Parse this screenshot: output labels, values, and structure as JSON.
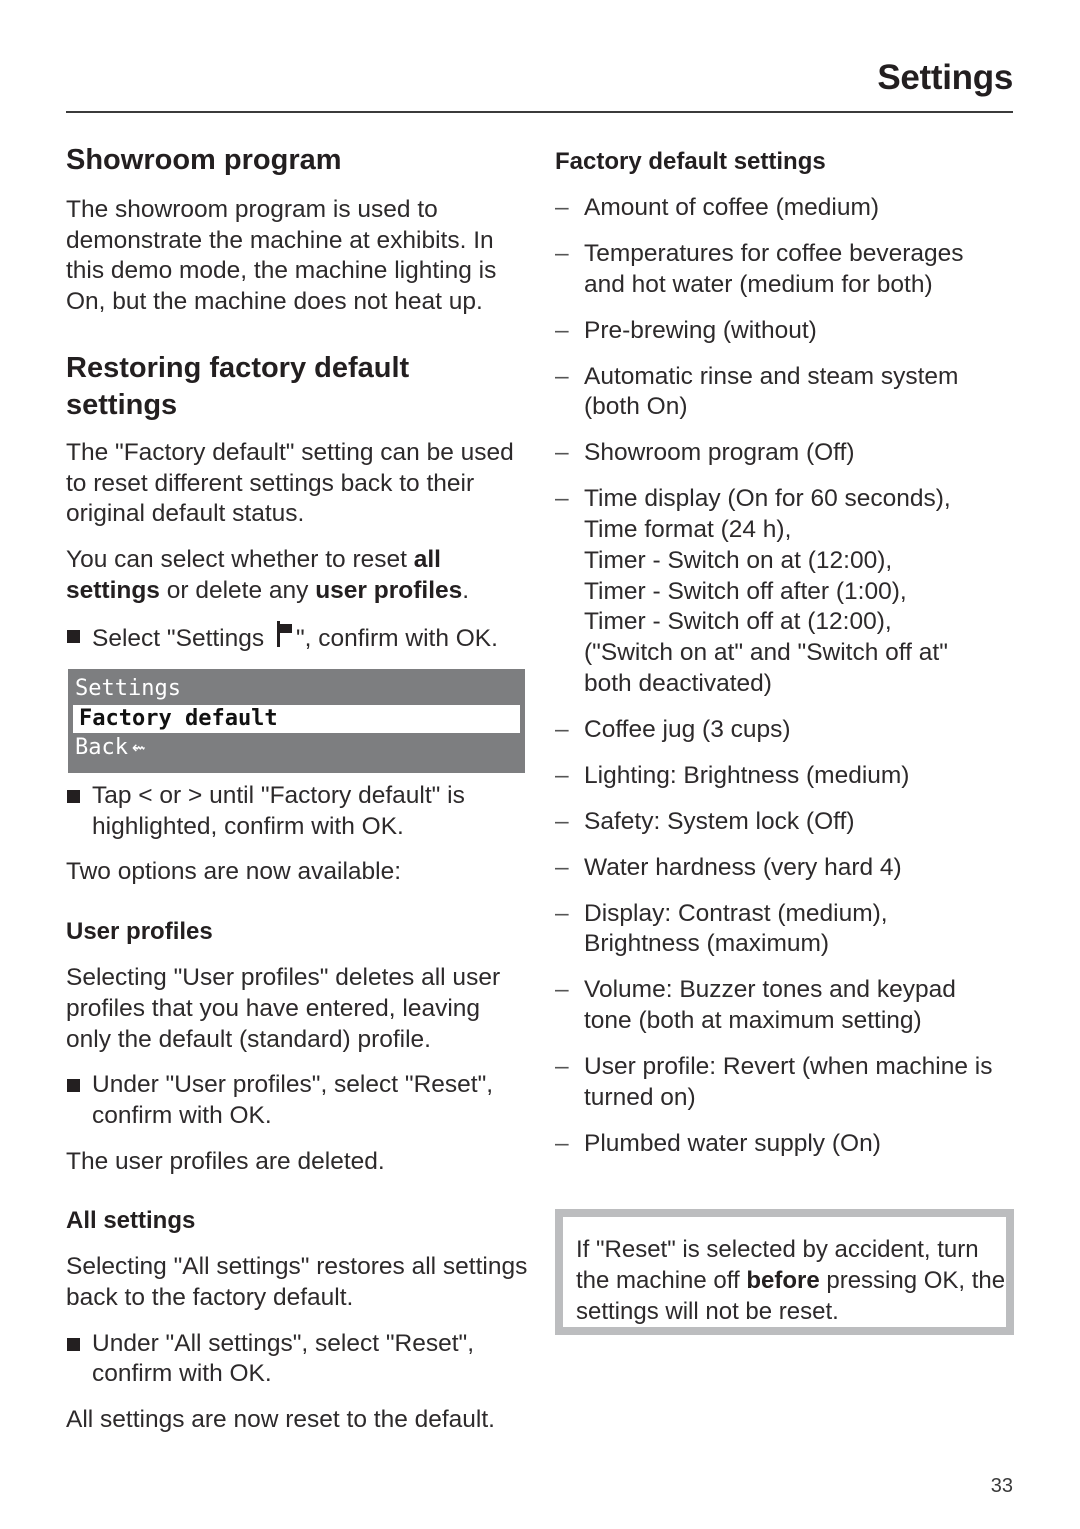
{
  "header": {
    "title": "Settings"
  },
  "left": {
    "showroom": {
      "heading": "Showroom program",
      "body": "The showroom program is used to demonstrate the machine at exhibits. In this demo mode, the machine lighting is On, but the machine does not heat up."
    },
    "restoring": {
      "heading": "Restoring factory default settings",
      "intro": "The \"Factory default\" setting can be used to reset different settings back to their original default status.",
      "select_pre": "You can select whether to reset ",
      "select_bold1": "all settings",
      "select_mid": " or delete any ",
      "select_bold2": "user profiles",
      "select_post": ".",
      "step1_pre": "Select \"Settings ",
      "step1_icon": "flag-icon",
      "step1_post": "\", confirm with OK.",
      "display": {
        "title": "Settings",
        "selected": "Factory default",
        "back": "Back",
        "back_icon": "⇜"
      },
      "step2": "Tap < or > until \"Factory default\" is highlighted, confirm with OK.",
      "options_text": "Two options are now available:"
    },
    "user_profiles": {
      "heading": "User profiles",
      "body": "Selecting \"User profiles\" deletes all user profiles that you have entered, leaving only the default (standard) profile.",
      "step": "Under \"User profiles\", select \"Reset\", confirm with OK.",
      "result": "The user profiles are deleted."
    },
    "all_settings": {
      "heading": "All settings",
      "body": "Selecting \"All settings\" restores all settings back to the factory default.",
      "step": "Under \"All settings\", select \"Reset\", confirm with OK.",
      "result": "All settings are now reset to the default."
    }
  },
  "right": {
    "heading": "Factory default settings",
    "dash": "–",
    "items": [
      "Amount of coffee (medium)",
      "Temperatures for coffee beverages\nand hot water (medium for both)",
      "Pre-brewing (without)",
      "Automatic rinse and steam system\n(both On)",
      "Showroom program (Off)",
      "Time display (On for 60 seconds),\nTime format (24 h),\nTimer - Switch on at (12:00),\nTimer - Switch off after (1:00),\nTimer - Switch off at (12:00),\n(\"Switch on at\" and \"Switch off at\"\nboth deactivated)",
      "Coffee jug (3 cups)",
      "Lighting: Brightness (medium)",
      "Safety: System lock (Off)",
      "Water hardness (very hard 4)",
      "Display: Contrast (medium),\nBrightness (maximum)",
      "Volume:  Buzzer tones and keypad\ntone (both at maximum setting)",
      "User profile: Revert (when machine is\nturned on)",
      "Plumbed water supply (On)"
    ],
    "note": {
      "pre": "If \"Reset\" is selected by accident, turn the machine off ",
      "bold": "before",
      "post": " pressing OK, the settings will not be reset."
    }
  },
  "footer": {
    "page_number": "33"
  }
}
